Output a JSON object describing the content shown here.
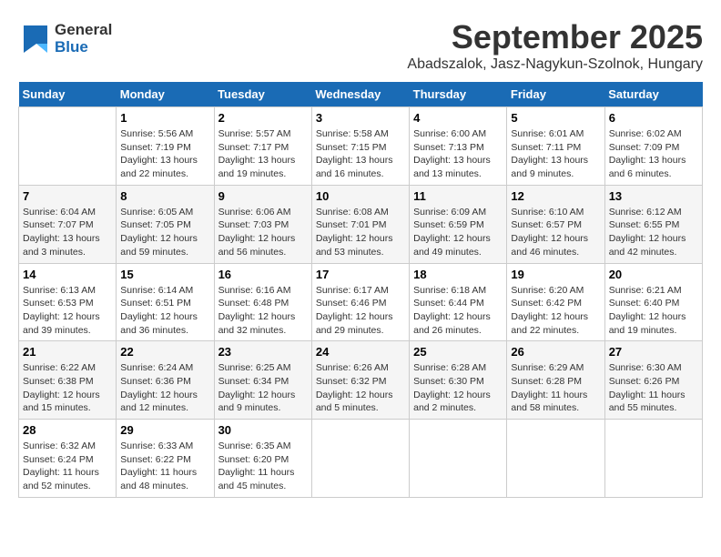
{
  "logo": {
    "general": "General",
    "blue": "Blue"
  },
  "title": "September 2025",
  "subtitle": "Abadszalok, Jasz-Nagykun-Szolnok, Hungary",
  "days_of_week": [
    "Sunday",
    "Monday",
    "Tuesday",
    "Wednesday",
    "Thursday",
    "Friday",
    "Saturday"
  ],
  "weeks": [
    [
      {
        "day": "",
        "info": ""
      },
      {
        "day": "1",
        "info": "Sunrise: 5:56 AM\nSunset: 7:19 PM\nDaylight: 13 hours\nand 22 minutes."
      },
      {
        "day": "2",
        "info": "Sunrise: 5:57 AM\nSunset: 7:17 PM\nDaylight: 13 hours\nand 19 minutes."
      },
      {
        "day": "3",
        "info": "Sunrise: 5:58 AM\nSunset: 7:15 PM\nDaylight: 13 hours\nand 16 minutes."
      },
      {
        "day": "4",
        "info": "Sunrise: 6:00 AM\nSunset: 7:13 PM\nDaylight: 13 hours\nand 13 minutes."
      },
      {
        "day": "5",
        "info": "Sunrise: 6:01 AM\nSunset: 7:11 PM\nDaylight: 13 hours\nand 9 minutes."
      },
      {
        "day": "6",
        "info": "Sunrise: 6:02 AM\nSunset: 7:09 PM\nDaylight: 13 hours\nand 6 minutes."
      }
    ],
    [
      {
        "day": "7",
        "info": "Sunrise: 6:04 AM\nSunset: 7:07 PM\nDaylight: 13 hours\nand 3 minutes."
      },
      {
        "day": "8",
        "info": "Sunrise: 6:05 AM\nSunset: 7:05 PM\nDaylight: 12 hours\nand 59 minutes."
      },
      {
        "day": "9",
        "info": "Sunrise: 6:06 AM\nSunset: 7:03 PM\nDaylight: 12 hours\nand 56 minutes."
      },
      {
        "day": "10",
        "info": "Sunrise: 6:08 AM\nSunset: 7:01 PM\nDaylight: 12 hours\nand 53 minutes."
      },
      {
        "day": "11",
        "info": "Sunrise: 6:09 AM\nSunset: 6:59 PM\nDaylight: 12 hours\nand 49 minutes."
      },
      {
        "day": "12",
        "info": "Sunrise: 6:10 AM\nSunset: 6:57 PM\nDaylight: 12 hours\nand 46 minutes."
      },
      {
        "day": "13",
        "info": "Sunrise: 6:12 AM\nSunset: 6:55 PM\nDaylight: 12 hours\nand 42 minutes."
      }
    ],
    [
      {
        "day": "14",
        "info": "Sunrise: 6:13 AM\nSunset: 6:53 PM\nDaylight: 12 hours\nand 39 minutes."
      },
      {
        "day": "15",
        "info": "Sunrise: 6:14 AM\nSunset: 6:51 PM\nDaylight: 12 hours\nand 36 minutes."
      },
      {
        "day": "16",
        "info": "Sunrise: 6:16 AM\nSunset: 6:48 PM\nDaylight: 12 hours\nand 32 minutes."
      },
      {
        "day": "17",
        "info": "Sunrise: 6:17 AM\nSunset: 6:46 PM\nDaylight: 12 hours\nand 29 minutes."
      },
      {
        "day": "18",
        "info": "Sunrise: 6:18 AM\nSunset: 6:44 PM\nDaylight: 12 hours\nand 26 minutes."
      },
      {
        "day": "19",
        "info": "Sunrise: 6:20 AM\nSunset: 6:42 PM\nDaylight: 12 hours\nand 22 minutes."
      },
      {
        "day": "20",
        "info": "Sunrise: 6:21 AM\nSunset: 6:40 PM\nDaylight: 12 hours\nand 19 minutes."
      }
    ],
    [
      {
        "day": "21",
        "info": "Sunrise: 6:22 AM\nSunset: 6:38 PM\nDaylight: 12 hours\nand 15 minutes."
      },
      {
        "day": "22",
        "info": "Sunrise: 6:24 AM\nSunset: 6:36 PM\nDaylight: 12 hours\nand 12 minutes."
      },
      {
        "day": "23",
        "info": "Sunrise: 6:25 AM\nSunset: 6:34 PM\nDaylight: 12 hours\nand 9 minutes."
      },
      {
        "day": "24",
        "info": "Sunrise: 6:26 AM\nSunset: 6:32 PM\nDaylight: 12 hours\nand 5 minutes."
      },
      {
        "day": "25",
        "info": "Sunrise: 6:28 AM\nSunset: 6:30 PM\nDaylight: 12 hours\nand 2 minutes."
      },
      {
        "day": "26",
        "info": "Sunrise: 6:29 AM\nSunset: 6:28 PM\nDaylight: 11 hours\nand 58 minutes."
      },
      {
        "day": "27",
        "info": "Sunrise: 6:30 AM\nSunset: 6:26 PM\nDaylight: 11 hours\nand 55 minutes."
      }
    ],
    [
      {
        "day": "28",
        "info": "Sunrise: 6:32 AM\nSunset: 6:24 PM\nDaylight: 11 hours\nand 52 minutes."
      },
      {
        "day": "29",
        "info": "Sunrise: 6:33 AM\nSunset: 6:22 PM\nDaylight: 11 hours\nand 48 minutes."
      },
      {
        "day": "30",
        "info": "Sunrise: 6:35 AM\nSunset: 6:20 PM\nDaylight: 11 hours\nand 45 minutes."
      },
      {
        "day": "",
        "info": ""
      },
      {
        "day": "",
        "info": ""
      },
      {
        "day": "",
        "info": ""
      },
      {
        "day": "",
        "info": ""
      }
    ]
  ]
}
